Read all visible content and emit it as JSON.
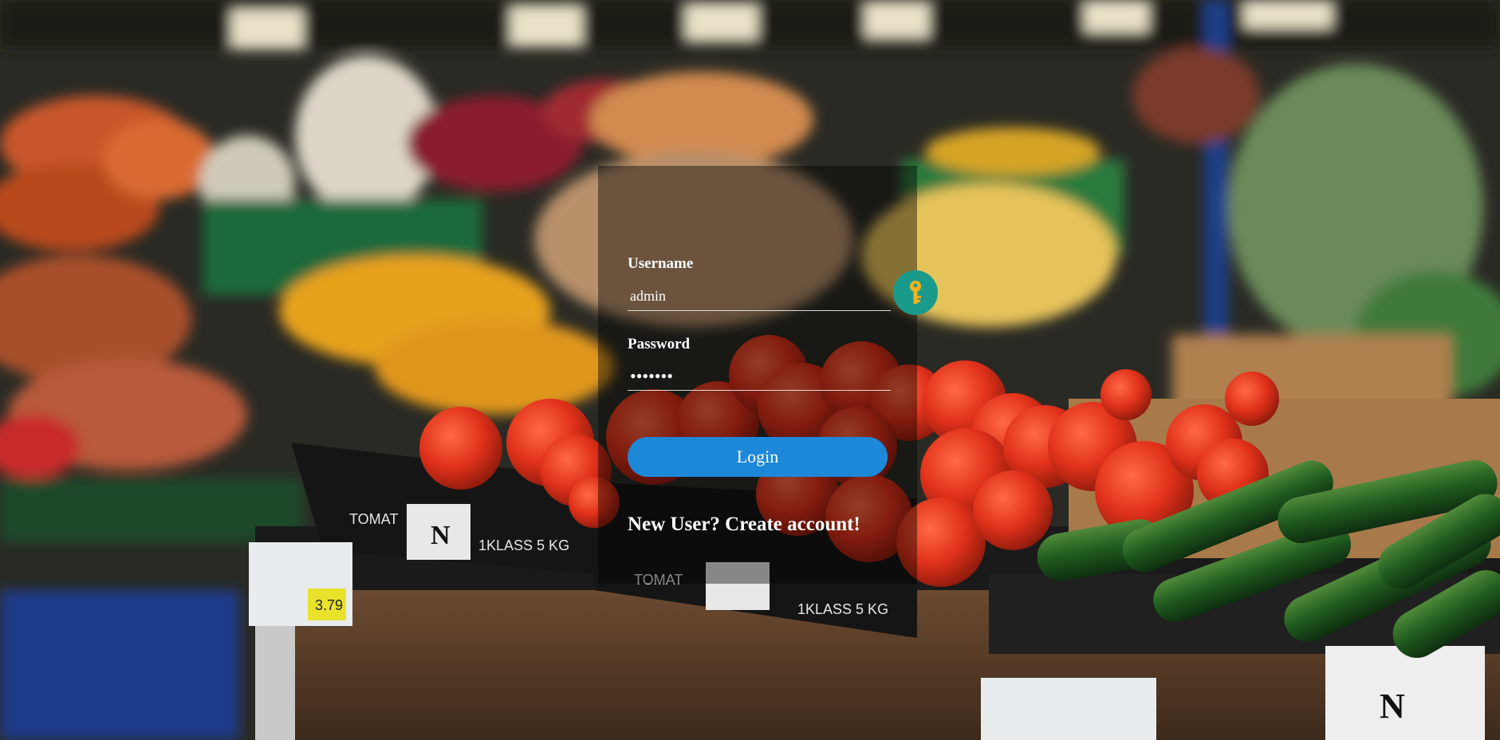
{
  "login": {
    "username_label": "Username",
    "username_value": "admin",
    "password_label": "Password",
    "password_value": "•••••••",
    "login_button": "Login",
    "create_account_link": "New User? Create account!"
  },
  "icons": {
    "key": "key-icon"
  },
  "colors": {
    "accent": "#1e88d8",
    "key_badge": "#1a9a8a",
    "key": "#f5b21a"
  },
  "background": {
    "price_tag": "3.79",
    "crate_label": "TOMAT",
    "crate_class": "1KLASS 5 KG",
    "crate_logo": "N"
  }
}
